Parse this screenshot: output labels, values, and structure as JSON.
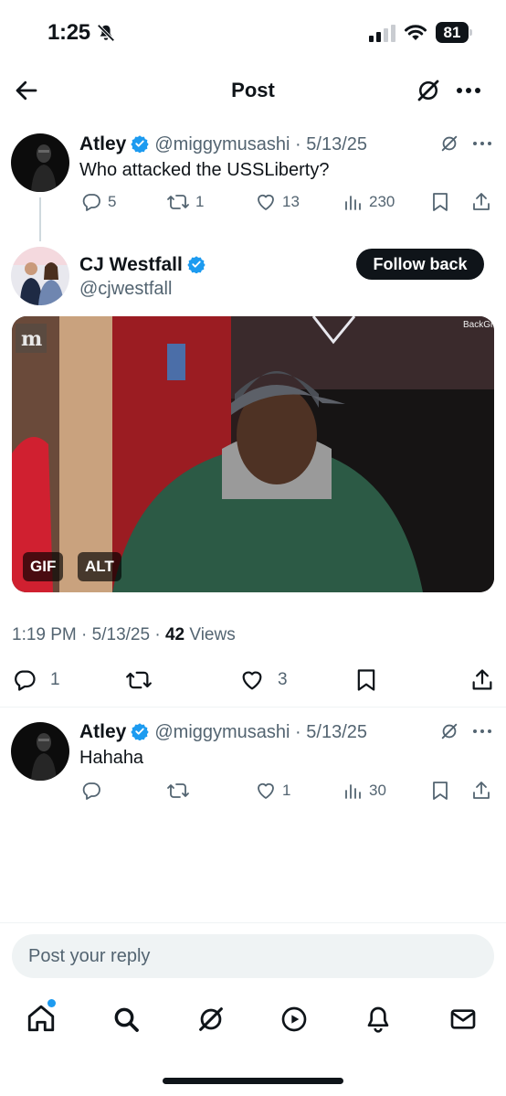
{
  "status_bar": {
    "time": "1:25",
    "battery": "81"
  },
  "header": {
    "title": "Post"
  },
  "parent_post": {
    "name": "Atley",
    "handle": "@miggymusashi",
    "date": "5/13/25",
    "text": "Who attacked the USSLiberty?",
    "replies": "5",
    "reposts": "1",
    "likes": "13",
    "views": "230"
  },
  "main_post": {
    "name": "CJ Westfall",
    "handle": "@cjwestfall",
    "follow_label": "Follow back",
    "media_badges": {
      "gif": "GIF",
      "alt": "ALT"
    },
    "media_watermark": "BackGr",
    "time": "1:19 PM",
    "date": "5/13/25",
    "views_count": "42",
    "views_label": "Views",
    "replies": "1",
    "likes": "3"
  },
  "reply_post": {
    "name": "Atley",
    "handle": "@miggymusashi",
    "date": "5/13/25",
    "text": "Hahaha",
    "likes": "1",
    "views": "30"
  },
  "reply_box": {
    "placeholder": "Post your reply"
  },
  "colors": {
    "verified": "#1d9bf0",
    "text": "#0f1419",
    "secondary": "#536471",
    "notification_dot": "#1d9bf0"
  },
  "bottom_nav": [
    "home-icon",
    "search-icon",
    "grok-icon",
    "video-icon",
    "notifications-icon",
    "messages-icon"
  ]
}
